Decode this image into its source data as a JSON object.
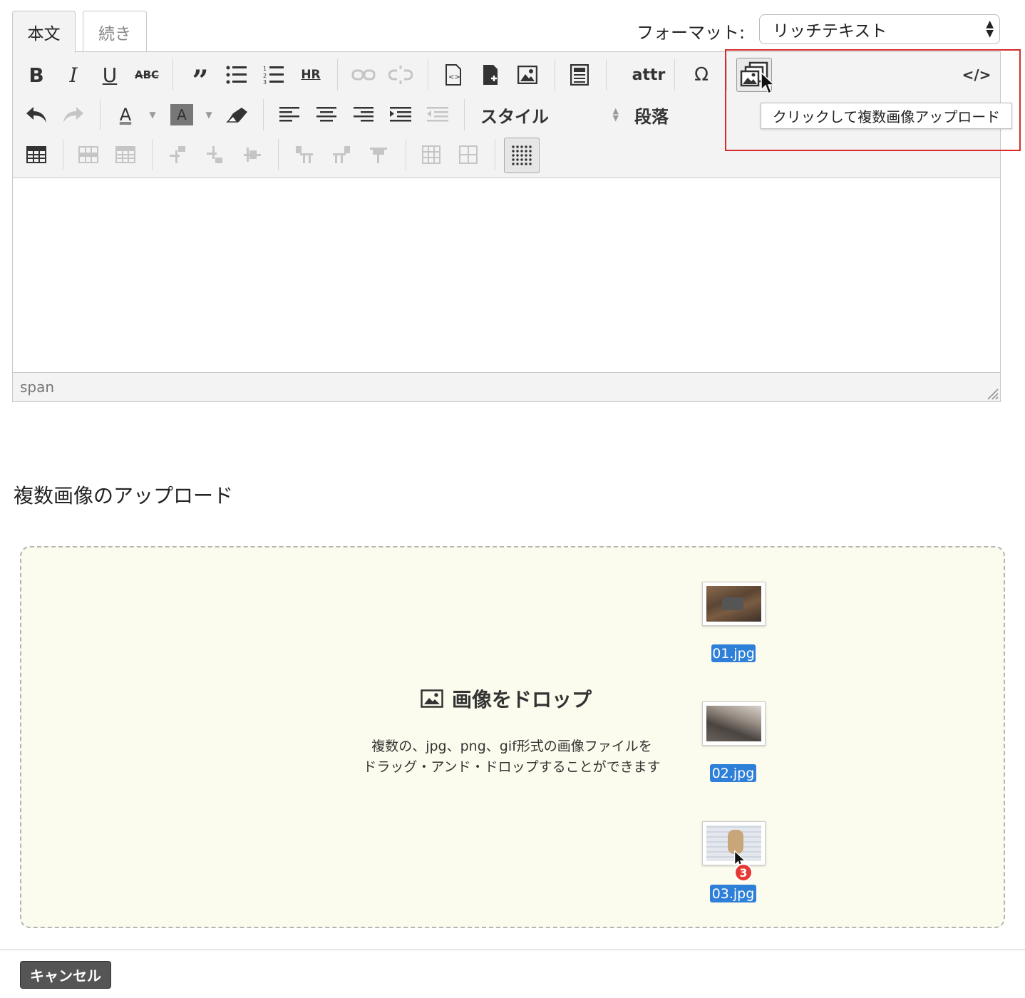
{
  "tabs": {
    "body": "本文",
    "more": "続き"
  },
  "format": {
    "label": "フォーマット:",
    "value": "リッチテキスト"
  },
  "toolbar": {
    "hr": "HR",
    "attr": "attr",
    "omega": "Ω",
    "code": "</>",
    "style": "スタイル",
    "paragraph": "段落",
    "text_color_glyph": "A",
    "bg_color_glyph": "A"
  },
  "tooltip": "クリックして複数画像アップロード",
  "statusbar": "span",
  "upload": {
    "title": "複数画像のアップロード",
    "drop_title": "画像をドロップ",
    "desc_line1": "複数の、jpg、png、gif形式の画像ファイルを",
    "desc_line2": "ドラッグ・アンド・ドロップすることができます",
    "files": [
      "01.jpg",
      "02.jpg",
      "03.jpg"
    ],
    "drag_count": "3"
  },
  "cancel": "キャンセル",
  "colors": {
    "highlight": "#d62b2b",
    "file_badge": "#2d7fd8",
    "count_badge": "#e53935",
    "dropzone_bg": "#fcfcee"
  }
}
